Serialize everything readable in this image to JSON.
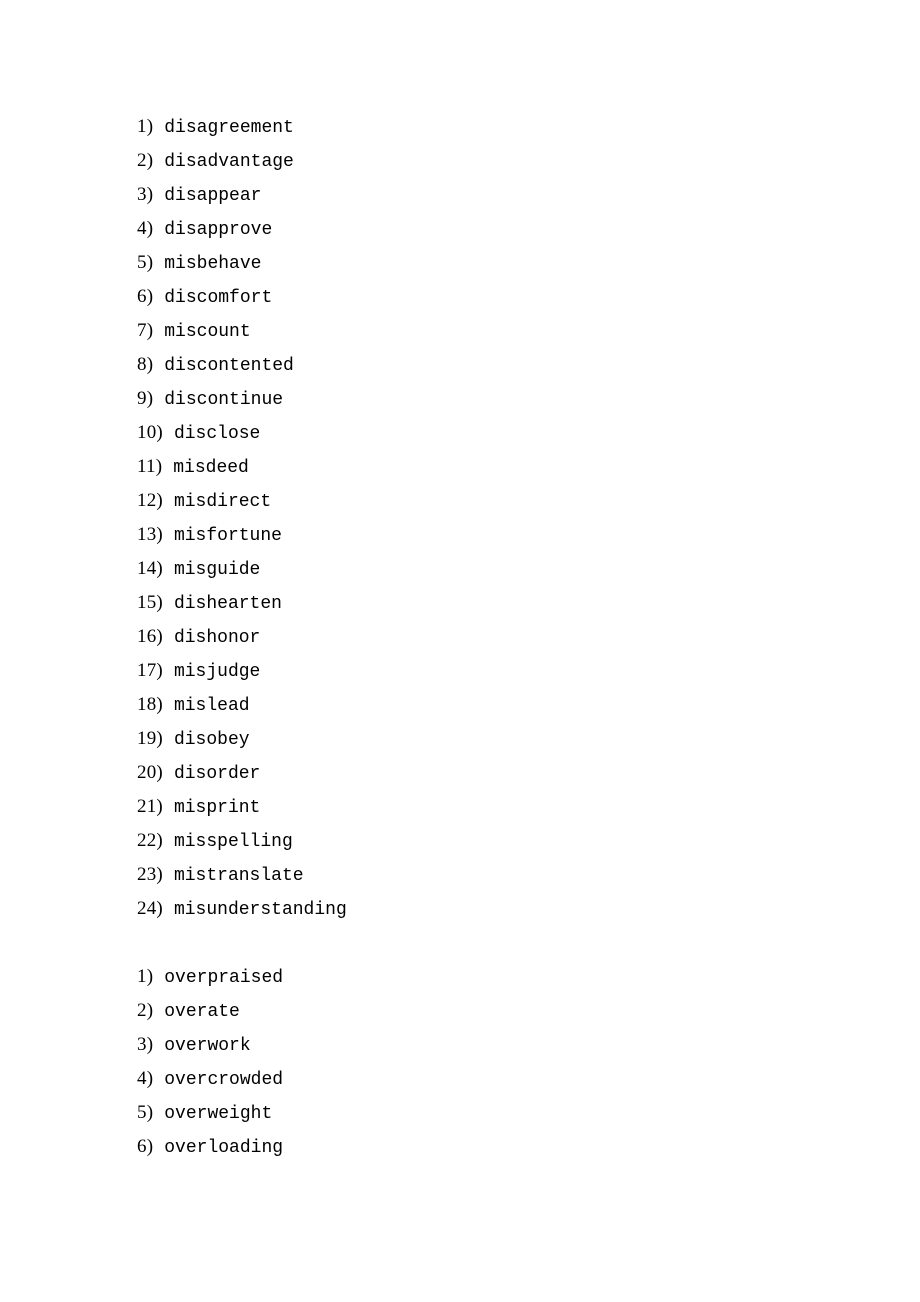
{
  "document": {
    "background_color": "#ffffff",
    "text_color": "#000000",
    "sections": [
      {
        "name": "dis-mis-prefix-list",
        "items": [
          {
            "number": "1)",
            "word": "disagreement"
          },
          {
            "number": "2)",
            "word": "disadvantage"
          },
          {
            "number": "3)",
            "word": "disappear"
          },
          {
            "number": "4)",
            "word": "disapprove"
          },
          {
            "number": "5)",
            "word": "misbehave"
          },
          {
            "number": "6)",
            "word": "discomfort"
          },
          {
            "number": "7)",
            "word": "miscount"
          },
          {
            "number": "8)",
            "word": "discontented"
          },
          {
            "number": "9)",
            "word": "discontinue"
          },
          {
            "number": "10)",
            "word": "disclose"
          },
          {
            "number": "11)",
            "word": "misdeed"
          },
          {
            "number": "12)",
            "word": "misdirect"
          },
          {
            "number": "13)",
            "word": "misfortune"
          },
          {
            "number": "14)",
            "word": "misguide"
          },
          {
            "number": "15)",
            "word": "dishearten"
          },
          {
            "number": "16)",
            "word": "dishonor"
          },
          {
            "number": "17)",
            "word": "misjudge"
          },
          {
            "number": "18)",
            "word": "mislead"
          },
          {
            "number": "19)",
            "word": "disobey"
          },
          {
            "number": "20)",
            "word": "disorder"
          },
          {
            "number": "21)",
            "word": "misprint"
          },
          {
            "number": "22)",
            "word": "misspelling"
          },
          {
            "number": "23)",
            "word": "mistranslate"
          },
          {
            "number": "24)",
            "word": "misunderstanding"
          }
        ]
      },
      {
        "name": "over-prefix-list",
        "items": [
          {
            "number": "1)",
            "word": "overpraised"
          },
          {
            "number": "2)",
            "word": "overate"
          },
          {
            "number": "3)",
            "word": "overwork"
          },
          {
            "number": "4)",
            "word": "overcrowded"
          },
          {
            "number": "5)",
            "word": "overweight"
          },
          {
            "number": "6)",
            "word": "overloading"
          }
        ]
      }
    ]
  }
}
